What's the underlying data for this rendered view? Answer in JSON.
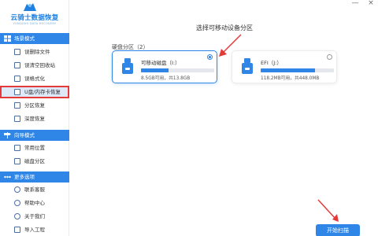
{
  "app": {
    "title": "云骑士数据恢复",
    "subtitle": "YUNQISHI DATA RECOVERY"
  },
  "window_controls": {
    "minimize": "—",
    "close": "×"
  },
  "sidebar": {
    "sections": [
      {
        "header": "场景模式",
        "items": [
          {
            "label": "误删除文件"
          },
          {
            "label": "误清空回收站"
          },
          {
            "label": "误格式化"
          },
          {
            "label": "U盘/内存卡恢复",
            "active": true
          },
          {
            "label": "分区恢复"
          },
          {
            "label": "深度恢复"
          }
        ]
      },
      {
        "header": "向导模式",
        "items": [
          {
            "label": "常用位置"
          },
          {
            "label": "磁盘分区"
          }
        ]
      },
      {
        "header": "更多选项",
        "items": [
          {
            "label": "联系客服"
          },
          {
            "label": "帮助中心"
          },
          {
            "label": "关于我们"
          },
          {
            "label": "导入工程"
          }
        ]
      }
    ]
  },
  "main": {
    "title": "选择可移动设备分区",
    "partition_label": "硬盘分区（2）",
    "cards": [
      {
        "name": "可移动磁盘（I:）",
        "info": "8.5GB可用，共13.8GB",
        "used_fraction": 0.38,
        "selected": true
      },
      {
        "name": "EFI（J:）",
        "info": "118.2MB可用，共448.0MB",
        "used_fraction": 0.74,
        "selected": false
      }
    ],
    "scan_button": "开始扫描"
  },
  "colors": {
    "accent": "#2f86e6",
    "highlight_border": "#e53a3a",
    "annotation_arrow": "#e53a3a",
    "active_bg": "#dde8f8"
  }
}
